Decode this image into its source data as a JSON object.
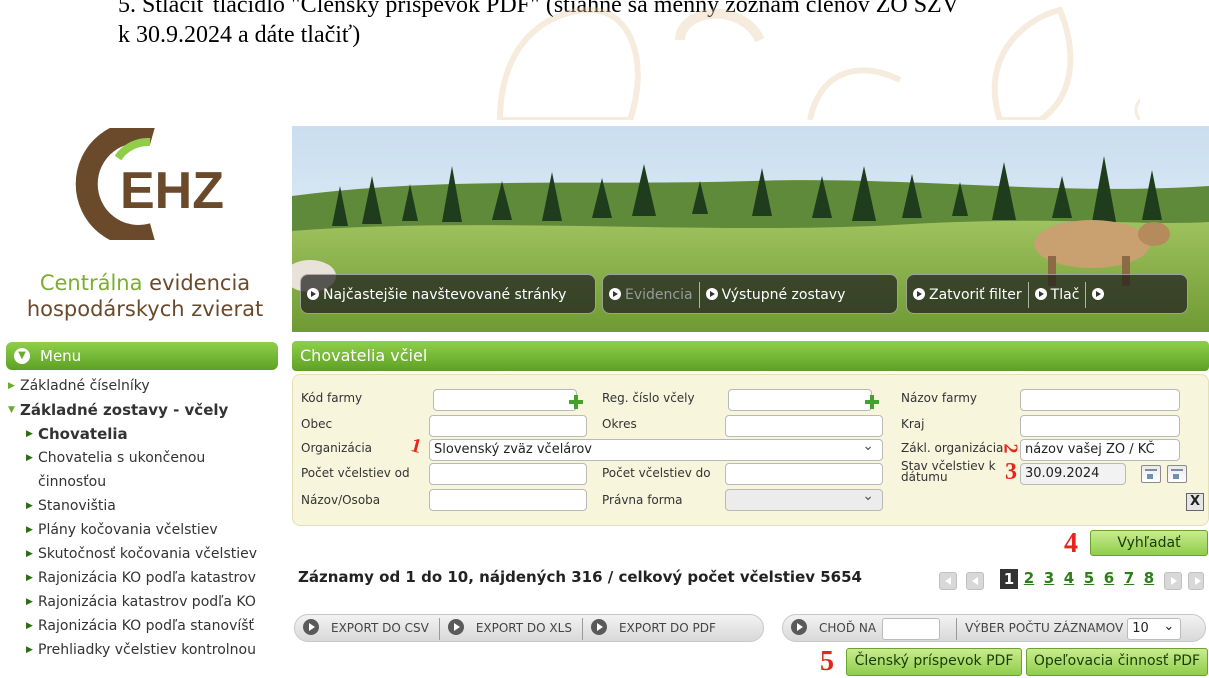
{
  "document": {
    "line1": "5.  Stlačiť tlačidlo \"Členský príspevok PDF\" (stiahne sa menný zoznam členov ZO SZV",
    "line2": "k 30.9.2024 a dáte tlačiť)"
  },
  "logo": {
    "mark_text": "EHZ",
    "caption_line1_green": "Centrálna",
    "caption_line1_rest": " evidencia",
    "caption_line2": "hospodárskych zvierat"
  },
  "sidebar": {
    "menu_title": "Menu",
    "items": [
      {
        "label": "Základné číselníky"
      },
      {
        "label": "Základné zostavy - včely"
      },
      {
        "label": "Chovatelia"
      },
      {
        "label": "Chovatelia s ukončenou"
      },
      {
        "label": "činnosťou"
      },
      {
        "label": "Stanovištia"
      },
      {
        "label": "Plány kočovania včelstiev"
      },
      {
        "label": "Skutočnosť kočovania včelstiev"
      },
      {
        "label": "Rajonizácia KO podľa katastrov"
      },
      {
        "label": "Rajonizácia katastrov podľa KO"
      },
      {
        "label": "Rajonizácia KO podľa stanovíšť"
      },
      {
        "label": "Prehliadky včelstiev kontrolnou"
      }
    ]
  },
  "nav": {
    "items": [
      {
        "label": "Najčastejšie navštevované stránky"
      },
      {
        "label": "Evidencia"
      },
      {
        "label": "Výstupné zostavy"
      },
      {
        "label": "Zatvoriť filter"
      },
      {
        "label": "Tlač"
      }
    ]
  },
  "page": {
    "title": "Chovatelia včiel"
  },
  "filter": {
    "kod_farmy": {
      "label": "Kód farmy",
      "value": ""
    },
    "reg_cislo": {
      "label": "Reg. číslo včely",
      "value": ""
    },
    "nazov_farmy": {
      "label": "Názov farmy",
      "value": ""
    },
    "obec": {
      "label": "Obec",
      "value": ""
    },
    "okres": {
      "label": "Okres",
      "value": ""
    },
    "kraj": {
      "label": "Kraj",
      "value": ""
    },
    "organizacia": {
      "label": "Organizácia",
      "value": "Slovenský zväz včelárov"
    },
    "zakl_organizacia": {
      "label": "Zákl. organizácia",
      "value": "názov vašej ZO / KČ"
    },
    "pocet_od": {
      "label": "Počet včelstiev od",
      "value": ""
    },
    "pocet_do": {
      "label": "Počet včelstiev do",
      "value": ""
    },
    "stav_k_datumu": {
      "label_line1": "Stav včelstiev k",
      "label_line2": "dátumu",
      "value": "30.09.2024"
    },
    "nazov_osoba": {
      "label": "Názov/Osoba",
      "value": ""
    },
    "pravna_forma": {
      "label": "Právna forma",
      "value": ""
    },
    "clear_label": "X"
  },
  "annotations": {
    "n1": "1",
    "n2": "2",
    "n3": "3",
    "n4": "4",
    "n5": "5"
  },
  "search_button": "Vyhľadať",
  "results": {
    "summary": "Záznamy od 1 do 10, nájdených 316 / celkový počet včelstiev 5654",
    "pages": [
      "1",
      "2",
      "3",
      "4",
      "5",
      "6",
      "7",
      "8"
    ],
    "current_page": "1"
  },
  "export": {
    "csv": "EXPORT DO CSV",
    "xls": "EXPORT DO XLS",
    "pdf": "EXPORT DO PDF",
    "goto": "CHOĎ NA",
    "records_choice": "VÝBER POČTU ZÁZNAMOV",
    "records_count": "10"
  },
  "actions": {
    "member_fee_pdf": "Členský príspevok PDF",
    "pollination_pdf": "Opeľovacia činnosť PDF"
  },
  "colors": {
    "accent_green": "#6aab2a",
    "brand_brown": "#6b4a2b",
    "annotation_red": "#e8251a"
  }
}
